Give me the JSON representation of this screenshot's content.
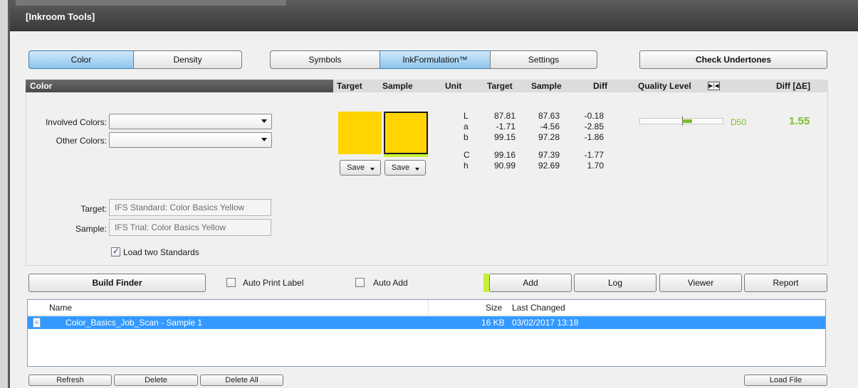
{
  "window": {
    "title": "[Inkroom Tools]"
  },
  "mode_tabs": [
    {
      "label": "Color",
      "active": true
    },
    {
      "label": "Density",
      "active": false
    }
  ],
  "main_tabs": [
    {
      "label": "Symbols",
      "active": false
    },
    {
      "label": "InkFormulation™",
      "active": true
    },
    {
      "label": "Settings",
      "active": false
    }
  ],
  "check_undertones_label": "Check Undertones",
  "color_section": {
    "header": "Color",
    "col_target": "Target",
    "col_sample": "Sample",
    "col_unit": "Unit",
    "col_target2": "Target",
    "col_sample2": "Sample",
    "col_diff": "Diff",
    "col_quality": "Quality Level",
    "col_diffde": "Diff [ΔE]"
  },
  "involved_colors_label": "Involved Colors:",
  "other_colors_label": "Other Colors:",
  "swatches": {
    "target_color": "#ffd400",
    "sample_color": "#ffd400",
    "save_label": "Save"
  },
  "measurements": [
    {
      "unit": "L",
      "target": "87.81",
      "sample": "87.63",
      "diff": "-0.18"
    },
    {
      "unit": "a",
      "target": "-1.71",
      "sample": "-4.56",
      "diff": "-2.85"
    },
    {
      "unit": "b",
      "target": "99.15",
      "sample": "97.28",
      "diff": "-1.86"
    },
    {
      "unit": "C",
      "target": "99.16",
      "sample": "97.39",
      "diff": "-1.77"
    },
    {
      "unit": "h",
      "target": "90.99",
      "sample": "92.69",
      "diff": "1.70"
    }
  ],
  "quality": {
    "illuminant": "D50",
    "delta_e": "1.55",
    "accent_color": "#7dbf2b"
  },
  "target_field": {
    "label": "Target:",
    "value": "IFS Standard: Color Basics Yellow"
  },
  "sample_field": {
    "label": "Sample:",
    "value": "IFS Trial: Color Basics Yellow"
  },
  "load_two_standards": {
    "label": "Load two Standards",
    "checked": true
  },
  "build_finder_label": "Build Finder",
  "auto_print_label": {
    "label": "Auto Print Label",
    "checked": false
  },
  "auto_add": {
    "label": "Auto Add",
    "checked": false
  },
  "actions": {
    "add": "Add",
    "log": "Log",
    "viewer": "Viewer",
    "report": "Report"
  },
  "file_list": {
    "columns": {
      "name": "Name",
      "size": "Size",
      "last_changed": "Last Changed"
    },
    "rows": [
      {
        "name": "Color_Basics_Job_Scan - Sample 1",
        "size": "16 KB",
        "last_changed": "03/02/2017 13:18",
        "selected": true
      }
    ]
  },
  "bottom_buttons": {
    "refresh": "Refresh",
    "delete": "Delete",
    "delete_all": "Delete All",
    "load_file": "Load File"
  }
}
